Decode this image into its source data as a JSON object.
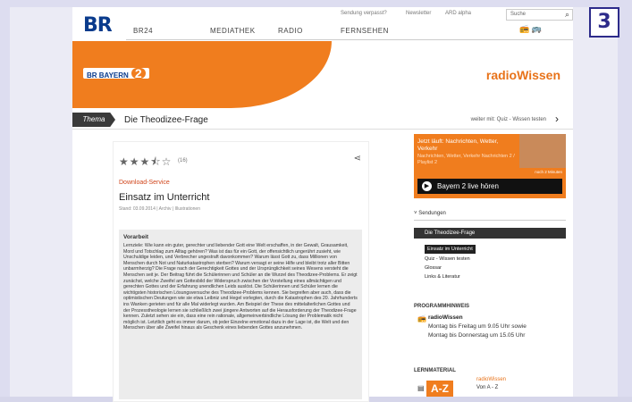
{
  "badge": "3",
  "header": {
    "logo": "BR",
    "util_links": [
      "Sendung verpasst?",
      "Newsletter",
      "ARD alpha"
    ],
    "search_placeholder": "Suche",
    "nav": [
      "BR24",
      "MEDIATHEK",
      "RADIO",
      "FERNSEHEN"
    ]
  },
  "hero": {
    "station_label": "BR BAYERN",
    "station_number": "2",
    "brand": "radioWissen"
  },
  "thema": {
    "tag": "Thema",
    "title": "Die Theodizee-Frage",
    "next_label": "weiter mit: Quiz - Wissen testen"
  },
  "article": {
    "rating": 3.5,
    "stars_text": "★★★⯪☆",
    "votes": "(16)",
    "download_label": "Download-Service",
    "headline": "Einsatz im Unterricht",
    "meta": "Stand: 03.09.2014 | Archiv | Illustrationen",
    "box_title": "Vorarbeit",
    "box_text": "Lernziele: Wie kann ein guter, gerechter und liebender Gott eine Welt erschaffen, in der Gewalt, Grausamkeit, Mord und Totschlag zum Alltag gehören? Was ist das für ein Gott, der offensichtlich ungerührt zusieht, wie Unschuldige leiden, und Verbrecher ungestraft davonkommen? Warum lässt Gott zu, dass Millionen von Menschen durch Not und Naturkatastrophen sterben? Warum versagt er seine Hilfe und bleibt trotz aller Bitten unbarmherzig? Die Frage nach der Gerechtigkeit Gottes und der Ursprünglichkeit seines Wesens versteht die Menschen seit je. Der Beitrag führt die Schülerinnen und Schüler an die Wurzel des Theodizee-Problems. Er zeigt zunächst, welche Zweifel am Gottesbild der Widerspruch zwischen der Vorstellung eines allmächtigen und gerechten Gottes und der Erfahrung unendlichen Leids auslöst. Die Schülerinnen und Schüler lernen die wichtigsten historischen Lösungsversuche des Theodizee-Problems kennen. Sie begreifen aber auch, dass die optimistischen Deutungen wie sie etwa Leibniz und Hegel vorlegten, durch die Katastrophen des 20. Jahrhunderts ins Wanken gerieten und für alle Mal widerlegt wurden. Am Beispiel der These des mittelalterlichen Gottes und der Prozesstheologie lernen sie schließlich zwei jüngere Antworten auf die Herausforderung der Theodizee-Frage kennen. Zuletzt sehen sie ein, dass eine rein rationale, allgemeinverbindliche Lösung der Problematik nicht möglich ist. Letztlich geht es immer darum, ob jeder Einzelne emotional dazu in der Lage ist, die Welt und den Menschen über alle Zweifel hinaus als Geschenk eines liebenden Gottes anzunehmen."
  },
  "sidebar": {
    "now_playing": "Jetzt läuft: Nachrichten, Wetter, Verkehr",
    "now_sub": "Nachrichten, Wetter, Verkehr Nachrichten 2 / Playlist 2",
    "time_left": "noch 2 Minuten",
    "live_button": "Bayern 2 live hören",
    "sendungen_label": "Sendungen",
    "sendung_active": "Die Theodizee-Frage",
    "sendung_items": [
      "Einsatz im Unterricht",
      "Quiz - Wissen testen",
      "Glossar",
      "Links & Literatur"
    ],
    "program_head": "PROGRAMMHINWEIS",
    "program_name": "radioWissen",
    "program_line1": "Montag bis Freitag um 9.05 Uhr sowie",
    "program_line2": "Montag bis Donnerstag um 15.05 Uhr",
    "lern_head": "LERNMATERIAL",
    "lern_brand": "radioWissen",
    "lern_title": "Von A - Z",
    "lern_book": "A-Z"
  },
  "colors": {
    "accent_orange": "#f07d1e",
    "br_blue": "#0a3b8c",
    "badge": "#2d2b8a"
  }
}
